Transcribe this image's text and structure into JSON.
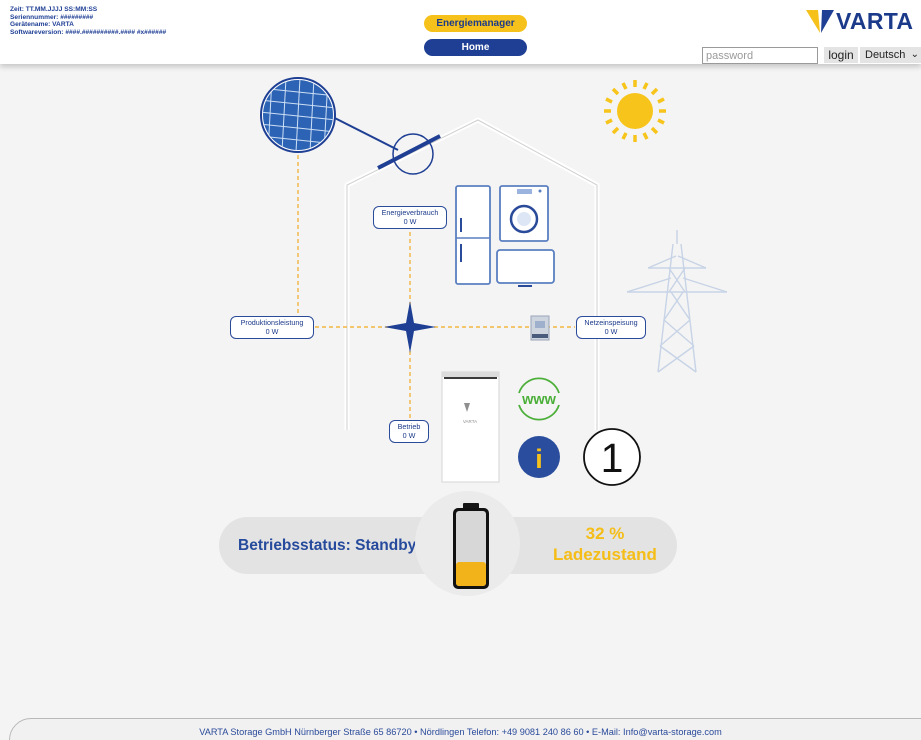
{
  "header": {
    "device_info": [
      "Zeit: TT.MM.JJJJ SS:MM:SS",
      "Seriennummer: #########",
      "Gerätename: VARTA",
      "Softwareversion: ####.##########.#### #x######"
    ],
    "energiemanager_label": "Energiemanager",
    "home_label": "Home",
    "logo_text": "VARTA",
    "password_placeholder": "password",
    "login_label": "login",
    "language_selected": "Deutsch"
  },
  "diagram": {
    "verbrauch": {
      "label": "Energieverbrauch",
      "value": "0 W"
    },
    "produktion": {
      "label": "Produktionsleistung",
      "value": "0 W"
    },
    "netz": {
      "label": "Netzeinspeisung",
      "value": "0 W"
    },
    "betrieb": {
      "label": "Betrieb",
      "value": "0 W"
    },
    "battery_logo_text": "VARTA",
    "www_text": "www",
    "info_glyph": "i",
    "number_glyph": "1"
  },
  "status": {
    "betriebsstatus": "Betriebsstatus: Standby",
    "percent": "32 %",
    "charge_level": 0.32,
    "ladezustand": "Ladezustand"
  },
  "footer": {
    "text": "VARTA Storage GmbH Nürnberger Straße 65 86720 • Nördlingen Telefon: +49 9081 240 86 60 • E-Mail: Info@varta-storage.com"
  },
  "colors": {
    "brand_blue": "#1e3f93",
    "brand_yellow": "#f5c11a",
    "flow_line": "#f2b640",
    "www_green": "#4caf3a"
  }
}
